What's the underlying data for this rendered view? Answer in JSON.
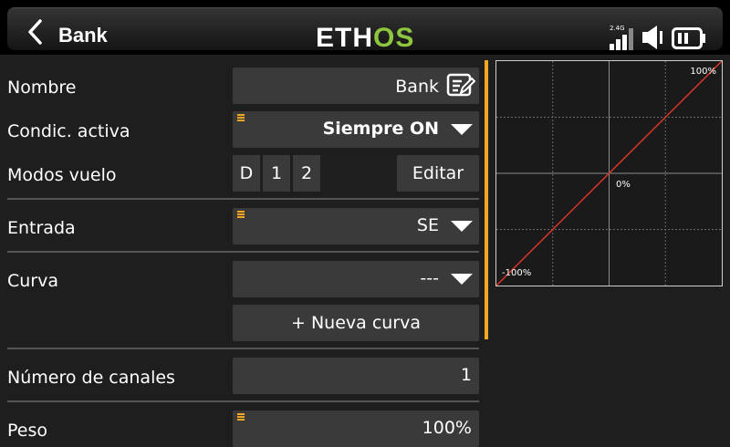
{
  "header": {
    "title": "Bank",
    "logo_part1": "ETH",
    "logo_part2": "OS",
    "rf_label": "2.4G"
  },
  "form": {
    "name_label": "Nombre",
    "name_value": "Bank",
    "condition_label": "Condic. activa",
    "condition_value": "Siempre ON",
    "flight_modes_label": "Modos vuelo",
    "flight_modes": [
      "D",
      "1",
      "2"
    ],
    "edit_label": "Editar",
    "input_label": "Entrada",
    "input_value": "SE",
    "curve_label": "Curva",
    "curve_value": "---",
    "new_curve_label": "+ Nueva curva",
    "channels_label": "Número de canales",
    "channels_value": "1",
    "weight_label": "Peso",
    "weight_value": "100%"
  },
  "graph": {
    "top_label": "100%",
    "center_label": "0%",
    "bottom_label": "-100%",
    "line_color": "#d9352a",
    "grid_color": "#6a6a6a"
  },
  "colors": {
    "accent": "#f5a623",
    "logo_green": "#8dc63f"
  }
}
